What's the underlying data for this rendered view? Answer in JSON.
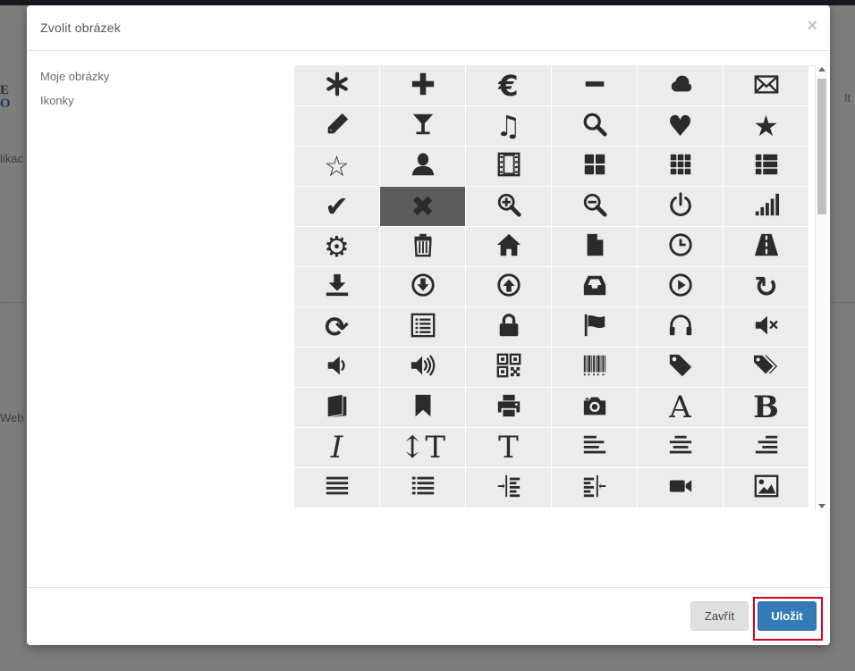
{
  "background": {
    "fragments": [
      "E",
      "O",
      "likac",
      "Web",
      "It"
    ]
  },
  "modal": {
    "title": "Zvolit obrázek",
    "close_glyph": "×"
  },
  "sidebar": {
    "items": [
      {
        "label": "Moje obrázky"
      },
      {
        "label": "Ikonky"
      }
    ]
  },
  "icons": {
    "selected_index": 19,
    "items": [
      {
        "name": "asterisk-icon"
      },
      {
        "name": "plus-icon"
      },
      {
        "name": "euro-icon",
        "glyph": "€"
      },
      {
        "name": "minus-icon"
      },
      {
        "name": "cloud-icon"
      },
      {
        "name": "envelope-icon"
      },
      {
        "name": "pencil-icon"
      },
      {
        "name": "glass-icon"
      },
      {
        "name": "music-icon",
        "glyph": "♫"
      },
      {
        "name": "search-icon"
      },
      {
        "name": "heart-icon",
        "glyph": "♥"
      },
      {
        "name": "star-icon",
        "glyph": "★"
      },
      {
        "name": "star-empty-icon",
        "glyph": "☆"
      },
      {
        "name": "user-icon"
      },
      {
        "name": "film-icon"
      },
      {
        "name": "th-large-icon"
      },
      {
        "name": "th-icon"
      },
      {
        "name": "th-list-icon"
      },
      {
        "name": "ok-icon",
        "glyph": "✔"
      },
      {
        "name": "remove-icon",
        "glyph": "✖"
      },
      {
        "name": "zoom-in-icon"
      },
      {
        "name": "zoom-out-icon"
      },
      {
        "name": "off-icon"
      },
      {
        "name": "signal-icon"
      },
      {
        "name": "cog-icon",
        "glyph": "⚙"
      },
      {
        "name": "trash-icon"
      },
      {
        "name": "home-icon"
      },
      {
        "name": "file-icon"
      },
      {
        "name": "time-icon"
      },
      {
        "name": "road-icon"
      },
      {
        "name": "download-alt-icon"
      },
      {
        "name": "download-icon"
      },
      {
        "name": "upload-icon"
      },
      {
        "name": "inbox-icon"
      },
      {
        "name": "play-circle-icon"
      },
      {
        "name": "repeat-icon",
        "glyph": "↻"
      },
      {
        "name": "refresh-icon",
        "glyph": "⟳"
      },
      {
        "name": "list-alt-icon"
      },
      {
        "name": "lock-icon"
      },
      {
        "name": "flag-icon"
      },
      {
        "name": "headphones-icon"
      },
      {
        "name": "volume-off-icon"
      },
      {
        "name": "volume-down-icon"
      },
      {
        "name": "volume-up-icon"
      },
      {
        "name": "qrcode-icon"
      },
      {
        "name": "barcode-icon"
      },
      {
        "name": "tag-icon"
      },
      {
        "name": "tags-icon"
      },
      {
        "name": "book-icon"
      },
      {
        "name": "bookmark-icon"
      },
      {
        "name": "print-icon"
      },
      {
        "name": "camera-icon"
      },
      {
        "name": "font-icon",
        "glyph": "A"
      },
      {
        "name": "bold-icon",
        "glyph": "B"
      },
      {
        "name": "italic-icon",
        "glyph": "I"
      },
      {
        "name": "text-height-icon",
        "glyph": "↕T"
      },
      {
        "name": "text-width-icon",
        "glyph": "T"
      },
      {
        "name": "align-left-icon"
      },
      {
        "name": "align-center-icon"
      },
      {
        "name": "align-right-icon"
      },
      {
        "name": "align-justify-icon"
      },
      {
        "name": "list-icon"
      },
      {
        "name": "indent-left-icon"
      },
      {
        "name": "indent-right-icon"
      },
      {
        "name": "facetime-video-icon"
      },
      {
        "name": "picture-icon"
      }
    ]
  },
  "footer": {
    "close_label": "Zavřít",
    "save_label": "Uložit",
    "highlight_color": "#d9001b"
  },
  "colors": {
    "primary": "#337ab7",
    "icon": "#2b2b2b",
    "cell_bg": "#ececec",
    "cell_selected_bg": "#5b5b5b"
  }
}
